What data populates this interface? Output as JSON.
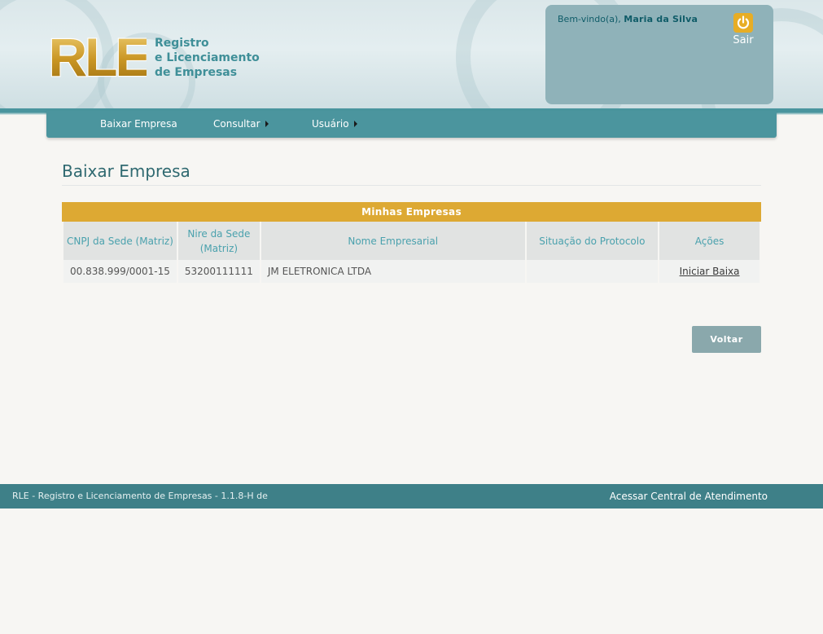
{
  "header": {
    "logo_letters": "RLE",
    "logo_lines": [
      "Registro",
      "e Licenciamento",
      "de Empresas"
    ],
    "welcome_prefix": "Bem-vindo(a),",
    "user_name": "Maria da Silva",
    "logout_label": "Sair"
  },
  "nav": {
    "items": [
      {
        "label": "Baixar Empresa",
        "has_submenu": false
      },
      {
        "label": "Consultar",
        "has_submenu": true
      },
      {
        "label": "Usuário",
        "has_submenu": true
      }
    ]
  },
  "main": {
    "title": "Baixar Empresa",
    "table": {
      "caption": "Minhas Empresas",
      "headers": [
        "CNPJ da Sede (Matriz)",
        "Nire da Sede (Matriz)",
        "Nome Empresarial",
        "Situação do Protocolo",
        "Ações"
      ],
      "rows": [
        {
          "cnpj": "00.838.999/0001-15",
          "nire": "53200111111",
          "nome": "JM ELETRONICA LTDA",
          "situacao": "",
          "acao": "Iniciar Baixa"
        }
      ]
    },
    "back_button": "Voltar"
  },
  "footer": {
    "left_text": "RLE - Registro e Licenciamento de Empresas - 1.1.8-H de",
    "right_link": "Acessar Central de Atendimento"
  },
  "colors": {
    "teal": "#4b959e",
    "gold": "#dda933",
    "footer": "#3e8088"
  }
}
